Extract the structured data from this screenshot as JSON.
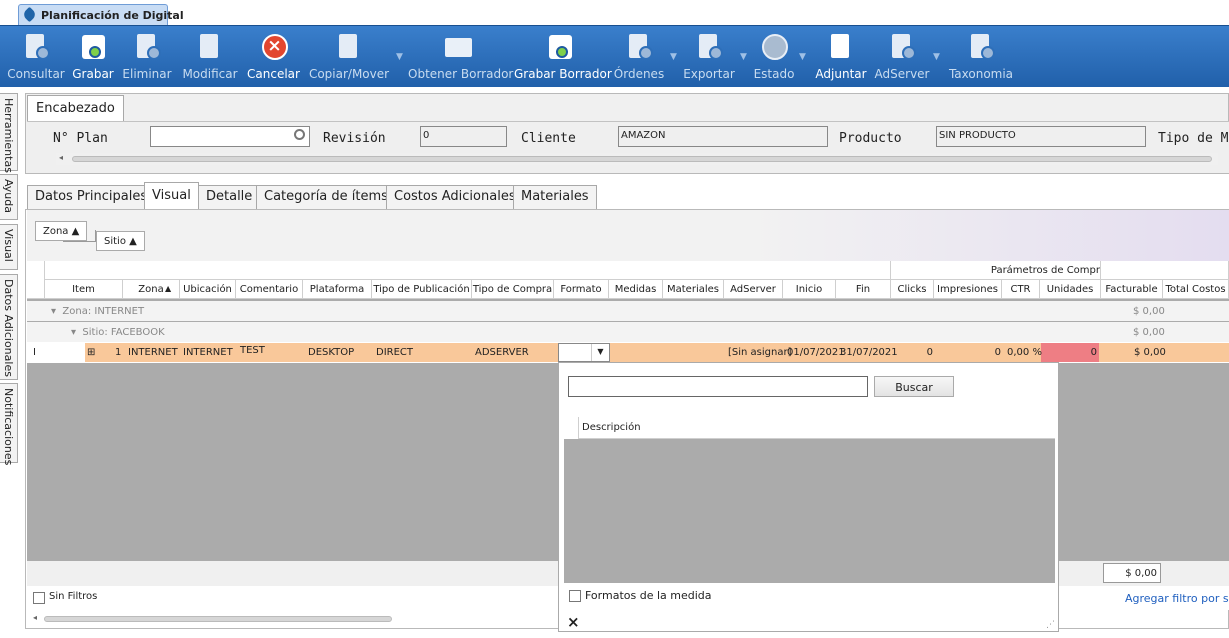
{
  "window": {
    "tab_title": "Planificación de Digital"
  },
  "toolbar": {
    "buttons": [
      {
        "label": "Consultar",
        "icon": "consult-icon"
      },
      {
        "label": "Grabar",
        "icon": "save-icon"
      },
      {
        "label": "Eliminar",
        "icon": "delete-icon"
      },
      {
        "label": "Modificar",
        "icon": "edit-icon"
      },
      {
        "label": "Cancelar",
        "icon": "cancel-icon"
      },
      {
        "label": "Copiar/Mover",
        "icon": "copy-icon"
      },
      {
        "label": "Obtener Borrador",
        "icon": "folder-icon"
      },
      {
        "label": "Grabar Borrador",
        "icon": "save-draft-icon"
      },
      {
        "label": "Órdenes",
        "icon": "orders-icon"
      },
      {
        "label": "Exportar",
        "icon": "export-icon"
      },
      {
        "label": "Estado",
        "icon": "status-icon"
      },
      {
        "label": "Adjuntar",
        "icon": "attach-icon"
      },
      {
        "label": "AdServer",
        "icon": "adserver-icon"
      },
      {
        "label": "Taxonomia",
        "icon": "taxonomy-icon"
      }
    ]
  },
  "side_tabs": [
    "Herramientas",
    "Ayuda",
    "Visual",
    "Datos Adicionales",
    "Notificaciones"
  ],
  "header": {
    "tab": "Encabezado",
    "plan_label": "N° Plan",
    "plan_value": "",
    "revision_label": "Revisión",
    "revision_value": "0",
    "cliente_label": "Cliente",
    "cliente_value": "AMAZON",
    "producto_label": "Producto",
    "producto_value": "SIN PRODUCTO",
    "tipo_label": "Tipo de Med"
  },
  "tabs": [
    "Datos Principales",
    "Visual",
    "Detalle",
    "Categoría de ítems",
    "Costos Adicionales",
    "Materiales"
  ],
  "grouping": {
    "zona": "Zona",
    "sitio": "Sitio"
  },
  "grid": {
    "band_label": "Parámetros de Compr",
    "columns": [
      "Item",
      "Zona",
      "Ubicación",
      "Comentario",
      "Plataforma",
      "Tipo de Publicación",
      "Tipo de Compra",
      "Formato",
      "Medidas",
      "Materiales",
      "AdServer",
      "Inicio",
      "Fin",
      "Clicks",
      "Impresiones",
      "CTR",
      "Unidades",
      "Facturable",
      "Total Costos"
    ],
    "group_zona": "Zona: INTERNET",
    "group_zona_total": "$ 0,00",
    "group_sitio": "Sitio: FACEBOOK",
    "group_sitio_total": "$ 0,00",
    "row": {
      "cursor": "I",
      "expand": "⊞",
      "item": "1",
      "zona": "INTERNET",
      "ubicacion": "INTERNET",
      "comentario": "TEST",
      "plataforma": "DESKTOP",
      "tipo_pub": "DIRECT",
      "tipo_compra": "ADSERVER",
      "formato": "",
      "adserver": "[Sin asignar]",
      "inicio": "01/07/2021",
      "fin": "31/07/2021",
      "clicks": "0",
      "impresiones": "0",
      "ctr": "0,00 %",
      "unidades": "0",
      "facturable": "$ 0,00"
    },
    "total": "$ 0,00"
  },
  "filter": {
    "sin_filtros": "Sin Filtros",
    "agregar": "Agregar filtro por sólo"
  },
  "dropdown": {
    "search_value": "",
    "search_button": "Buscar",
    "column": "Descripción",
    "checkbox_label": "Formatos de la medida",
    "close": "×"
  }
}
